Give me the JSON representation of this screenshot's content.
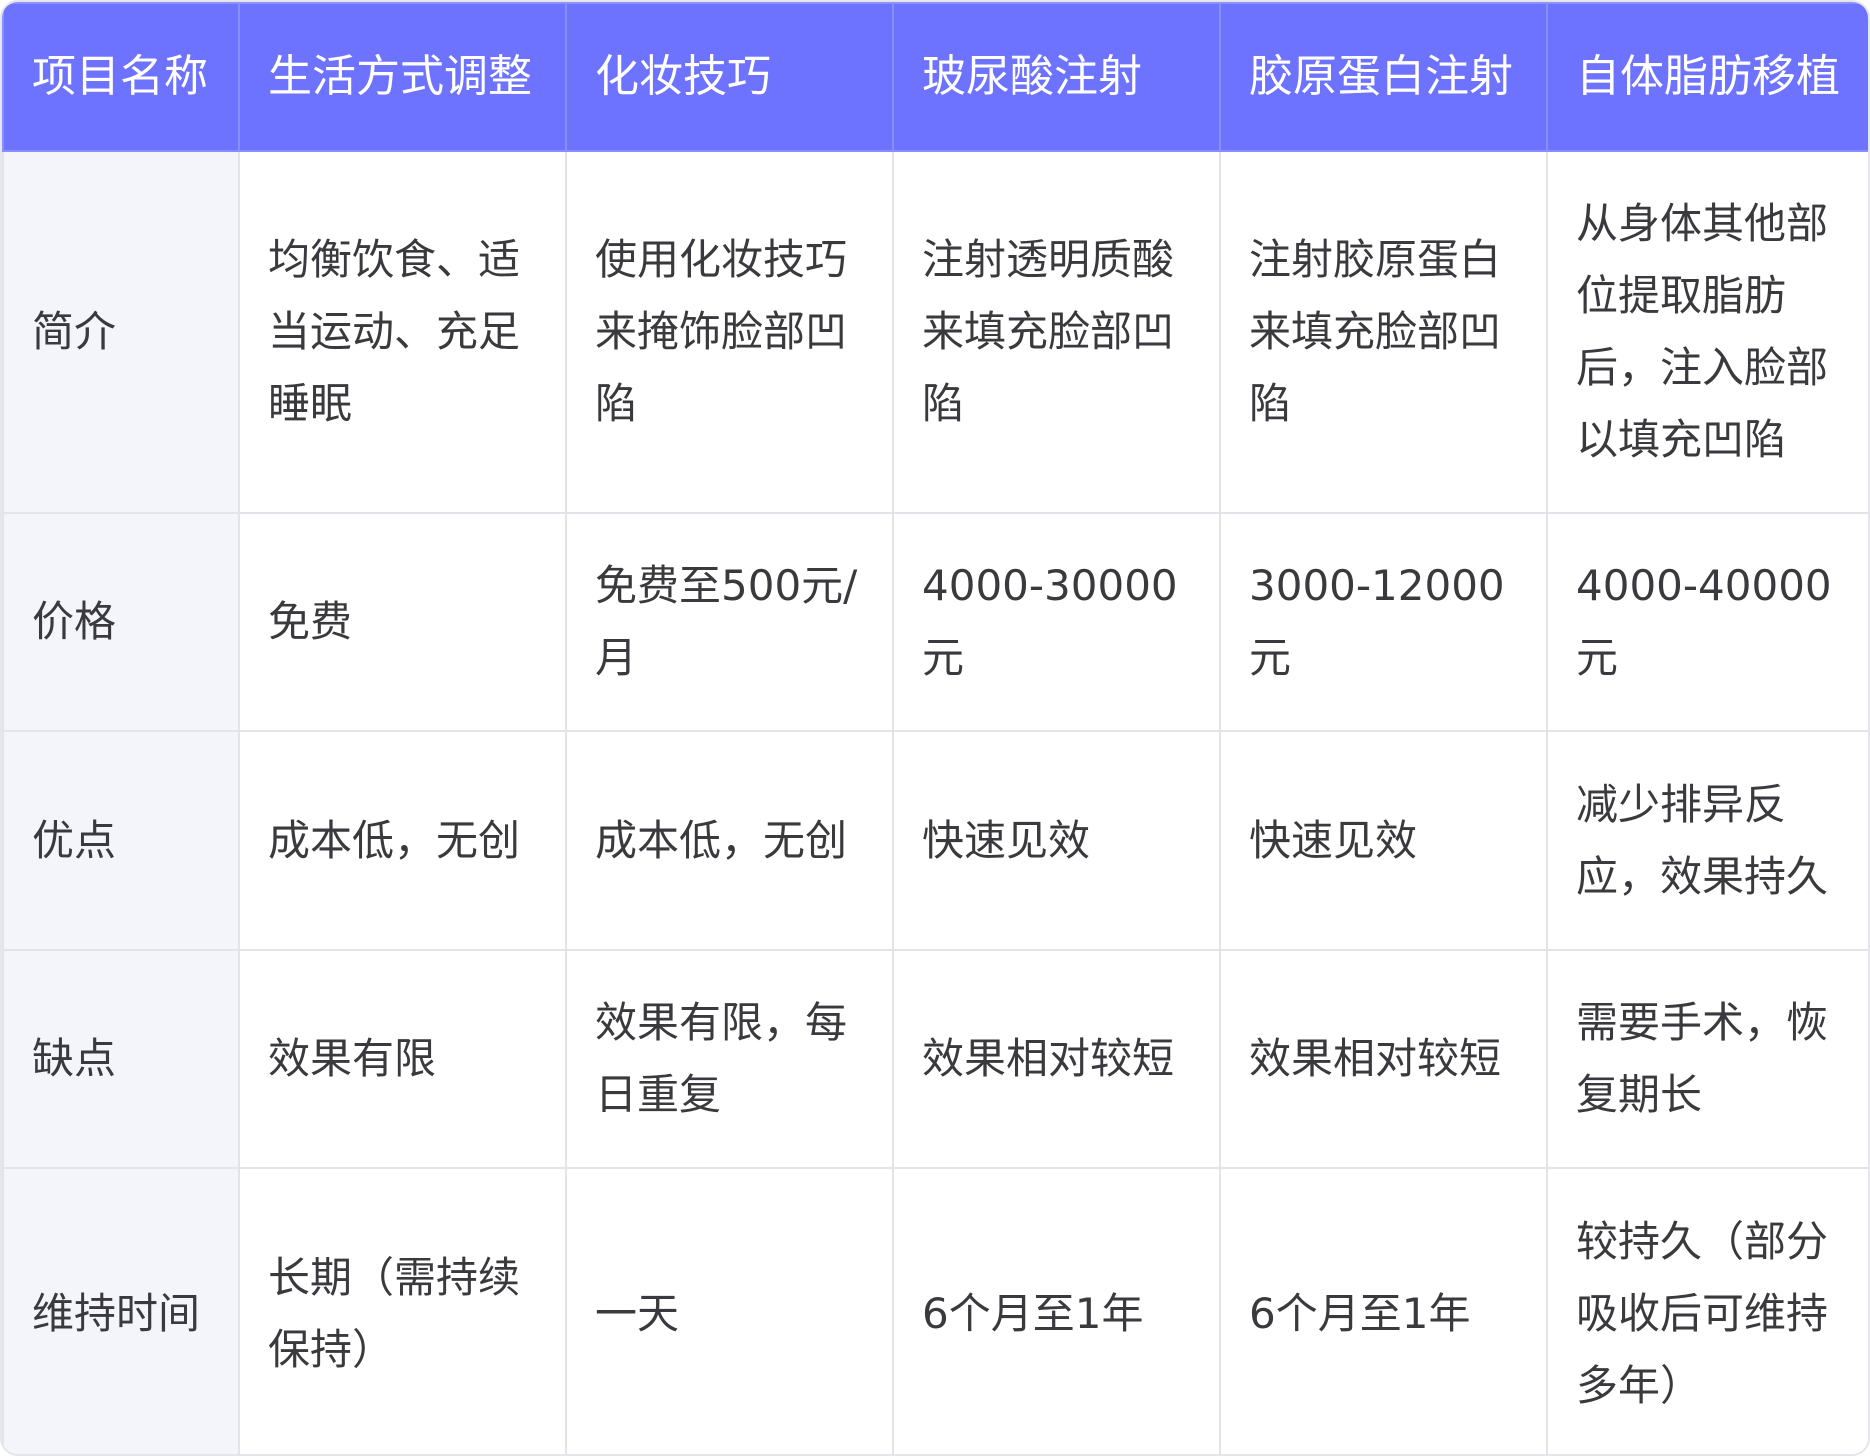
{
  "header": [
    "项目名称",
    "生活方式调整",
    "化妆技巧",
    "玻尿酸注射",
    "胶原蛋白注射",
    "自体脂肪移植"
  ],
  "rows": [
    {
      "label": "简介",
      "cells": [
        "均衡饮食、适当运动、充足睡眠",
        "使用化妆技巧来掩饰脸部凹陷",
        "注射透明质酸来填充脸部凹陷",
        "注射胶原蛋白来填充脸部凹陷",
        "从身体其他部位提取脂肪后，注入脸部以填充凹陷"
      ]
    },
    {
      "label": "价格",
      "cells": [
        "免费",
        "免费至500元/月",
        "4000-30000元",
        "3000-12000元",
        "4000-40000元"
      ]
    },
    {
      "label": "优点",
      "cells": [
        "成本低，无创",
        "成本低，无创",
        "快速见效",
        "快速见效",
        "减少排异反应，效果持久"
      ]
    },
    {
      "label": "缺点",
      "cells": [
        "效果有限",
        "效果有限，每日重复",
        "效果相对较短",
        "效果相对较短",
        "需要手术，恢复期长"
      ]
    },
    {
      "label": "维持时间",
      "cells": [
        "长期（需持续保持）",
        "一天",
        "6个月至1年",
        "6个月至1年",
        "较持久（部分吸收后可维持多年）"
      ]
    }
  ]
}
